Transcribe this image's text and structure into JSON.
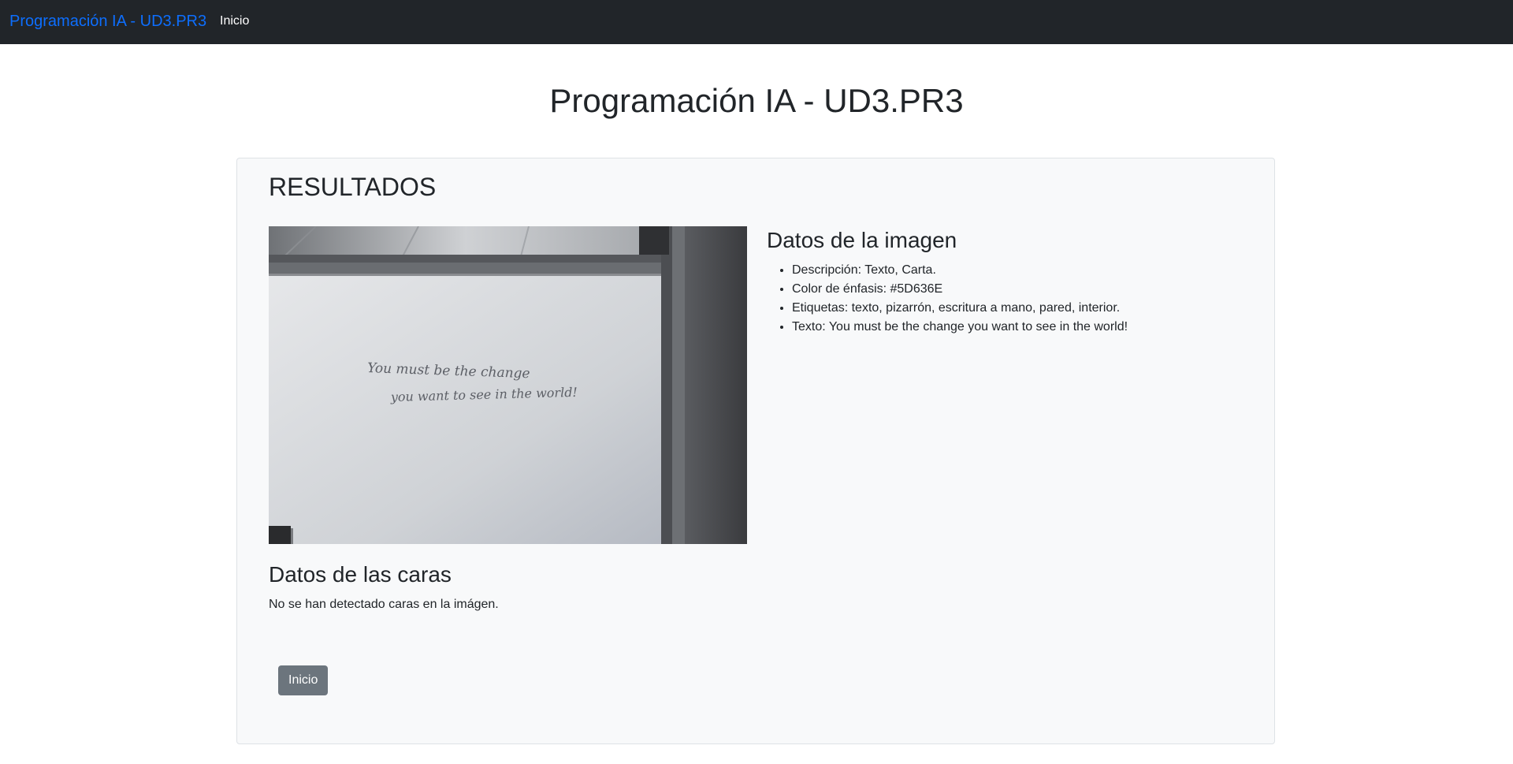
{
  "navbar": {
    "brand": "Programación IA - UD3.PR3",
    "links": [
      {
        "label": "Inicio"
      }
    ]
  },
  "page": {
    "title": "Programación IA - UD3.PR3"
  },
  "results": {
    "title": "RESULTADOS",
    "image": {
      "handwritten_line1": "You must be the change",
      "handwritten_line2": "you want to see in the world!"
    },
    "image_data": {
      "title": "Datos de la imagen",
      "items": [
        "Descripción: Texto, Carta.",
        "Color de énfasis: #5D636E",
        "Etiquetas: texto, pizarrón, escritura a mano, pared, interior.",
        "Texto: You must be the change you want to see in the world!"
      ]
    },
    "faces": {
      "title": "Datos de las caras",
      "message": "No se han detectado caras en la imágen."
    },
    "home_button": "Inicio"
  },
  "colors": {
    "navbar_bg": "#212529",
    "brand": "#0d6efd",
    "card_bg": "#f8f9fa",
    "button_bg": "#6c757d",
    "accent": "#5D636E"
  }
}
